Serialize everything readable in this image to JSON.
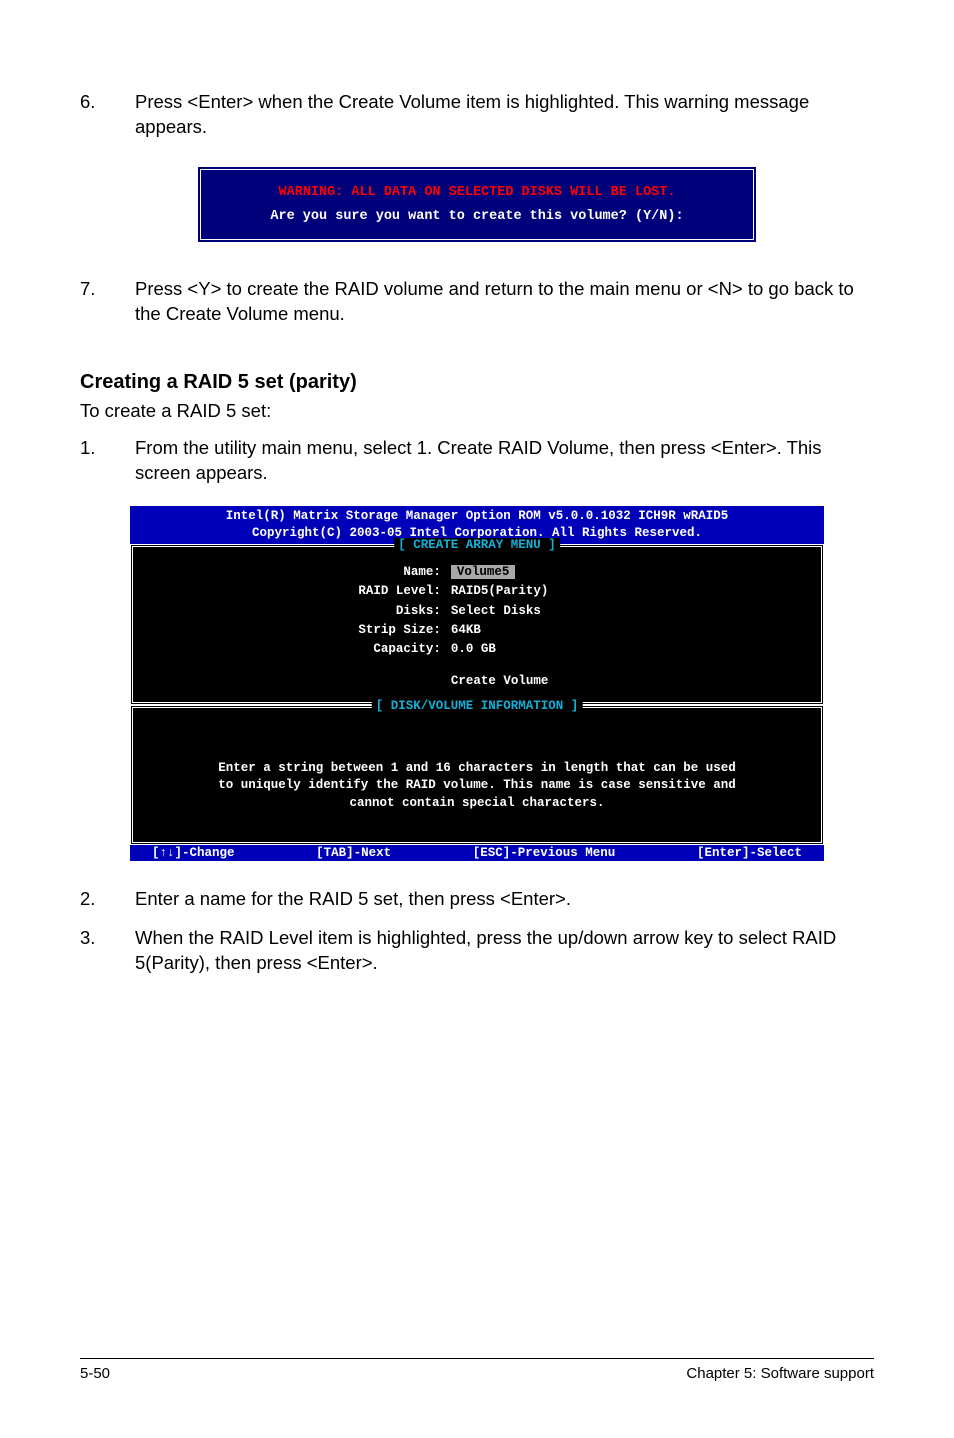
{
  "steps_a": [
    {
      "num": "6.",
      "text": "Press <Enter> when the Create Volume item is highlighted. This warning message appears."
    }
  ],
  "dialog": {
    "warning": "WARNING: ALL DATA ON SELECTED DISKS WILL BE LOST.",
    "confirm": "Are you sure you want to create this volume? (Y/N):"
  },
  "steps_b": [
    {
      "num": "7.",
      "text": "Press <Y> to create the RAID volume and return to the main menu or <N> to go back to the Create Volume menu."
    }
  ],
  "heading": "Creating a RAID 5 set (parity)",
  "sub": "To create a RAID 5 set:",
  "steps_c": [
    {
      "num": "1.",
      "text": "From the utility main menu, select 1. Create RAID Volume, then press <Enter>. This screen appears."
    }
  ],
  "bios": {
    "header1": "Intel(R) Matrix Storage Manager Option ROM v5.0.0.1032 ICH9R wRAID5",
    "header2": "Copyright(C) 2003-05 Intel Corporation. All Rights Reserved.",
    "panel1_title": "[ CREATE ARRAY MENU ]",
    "fields": {
      "name_label": "Name:",
      "name_value": "Volume5",
      "raid_label": "RAID Level:",
      "raid_value": "RAID5(Parity)",
      "disks_label": "Disks:",
      "disks_value": "Select Disks",
      "strip_label": "Strip Size:",
      "strip_value": "64KB",
      "cap_label": "Capacity:",
      "cap_value": "0.0  GB"
    },
    "create_volume": "Create Volume",
    "panel2_title": "[ DISK/VOLUME INFORMATION ]",
    "info1": "Enter a string between 1 and 16 characters in length that can be used",
    "info2": "to uniquely identify the RAID volume. This name is case sensitive and",
    "info3": "cannot contain special characters.",
    "footer": {
      "change": "[↑↓]-Change",
      "next": "[TAB]-Next",
      "prev": "[ESC]-Previous Menu",
      "select": "[Enter]-Select"
    }
  },
  "steps_d": [
    {
      "num": "2.",
      "text": "Enter a name for the RAID 5 set, then press <Enter>."
    },
    {
      "num": "3.",
      "text": "When the RAID Level item is highlighted, press the up/down arrow key to select RAID 5(Parity), then press <Enter>."
    }
  ],
  "footer": {
    "left": "5-50",
    "right": "Chapter 5: Software support"
  }
}
